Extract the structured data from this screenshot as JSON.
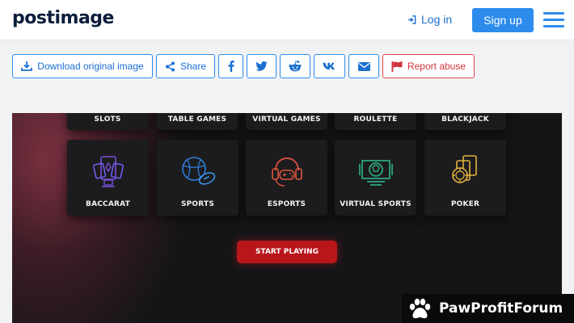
{
  "header": {
    "logo": "postimage",
    "login_label": "Log in",
    "signup_label": "Sign up"
  },
  "toolbar": {
    "download_label": "Download original image",
    "share_label": "Share",
    "report_label": "Report abuse"
  },
  "image": {
    "top_row": [
      "SLOTS",
      "TABLE GAMES",
      "VIRTUAL GAMES",
      "ROULETTE",
      "BLACKJACK"
    ],
    "tiles": [
      {
        "label": "BACCARAT",
        "icon": "baccarat-icon",
        "color": "#7b4fd6"
      },
      {
        "label": "SPORTS",
        "icon": "sports-balls-icon",
        "color": "#2f7fd9"
      },
      {
        "label": "ESPORTS",
        "icon": "gamer-headset-icon",
        "color": "#e0553d"
      },
      {
        "label": "VIRTUAL SPORTS",
        "icon": "virtual-football-icon",
        "color": "#2fbf8f"
      },
      {
        "label": "POKER",
        "icon": "poker-chip-cards-icon",
        "color": "#e2b13c"
      }
    ],
    "cta_label": "START PLAYING"
  },
  "watermark": {
    "text": "PawProfitForum"
  },
  "colors": {
    "accent": "#2d8ceb",
    "danger": "#d0343c",
    "cta": "#b8161b"
  }
}
